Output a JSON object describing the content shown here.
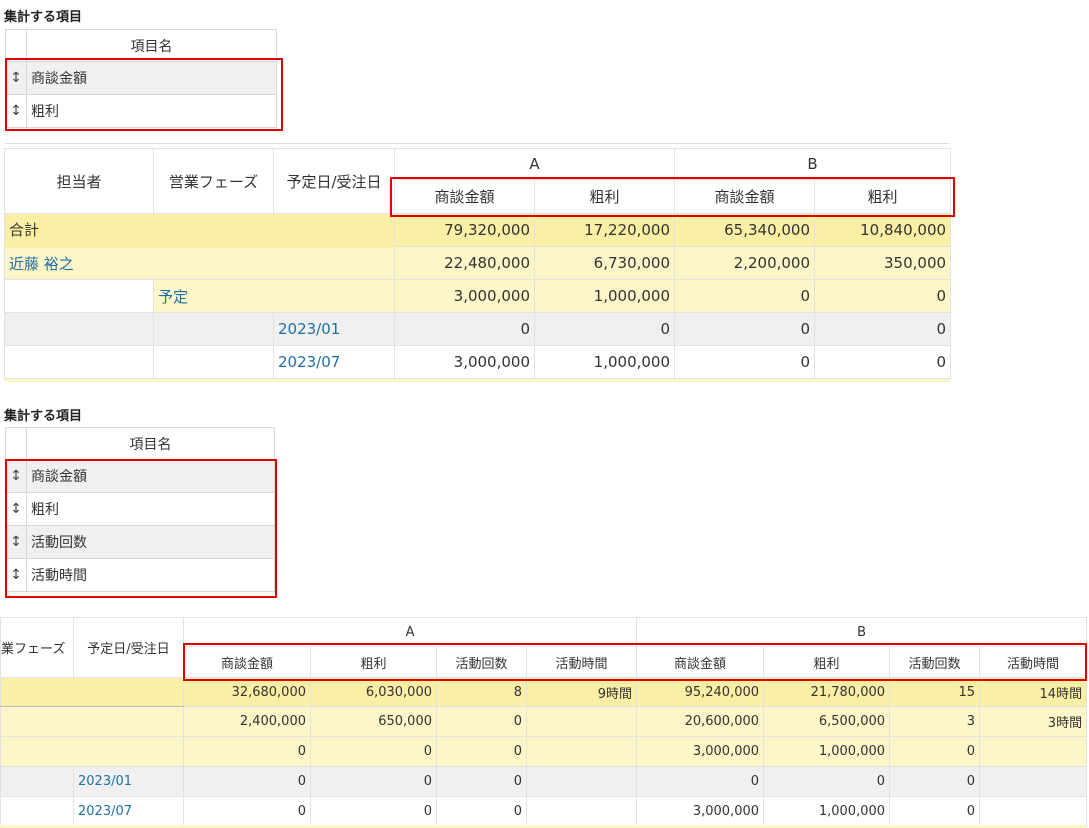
{
  "section1": {
    "title": "集計する項目",
    "header": "項目名",
    "items": [
      {
        "grip": "↕",
        "label": "商談金額"
      },
      {
        "grip": "↕",
        "label": "粗利"
      }
    ]
  },
  "pivot1": {
    "row_headers": [
      "担当者",
      "営業フェーズ",
      "予定日/受注日"
    ],
    "groups": [
      "A",
      "B"
    ],
    "measures": [
      "商談金額",
      "粗利",
      "商談金額",
      "粗利"
    ],
    "rows": [
      {
        "label": "合計",
        "values": [
          "79,320,000",
          "17,220,000",
          "65,340,000",
          "10,840,000"
        ]
      },
      {
        "label": "近藤 裕之",
        "values": [
          "22,480,000",
          "6,730,000",
          "2,200,000",
          "350,000"
        ]
      },
      {
        "label": "予定",
        "values": [
          "3,000,000",
          "1,000,000",
          "0",
          "0"
        ]
      },
      {
        "label": "2023/01",
        "values": [
          "0",
          "0",
          "0",
          "0"
        ]
      },
      {
        "label": "2023/07",
        "values": [
          "3,000,000",
          "1,000,000",
          "0",
          "0"
        ]
      }
    ]
  },
  "section2": {
    "title": "集計する項目",
    "header": "項目名",
    "items": [
      {
        "grip": "↕",
        "label": "商談金額"
      },
      {
        "grip": "↕",
        "label": "粗利"
      },
      {
        "grip": "↕",
        "label": "活動回数"
      },
      {
        "grip": "↕",
        "label": "活動時間"
      }
    ]
  },
  "pivot2": {
    "row_headers": [
      "業フェーズ",
      "予定日/受注日"
    ],
    "groups": [
      "A",
      "B"
    ],
    "measures": [
      "商談金額",
      "粗利",
      "活動回数",
      "活動時間",
      "商談金額",
      "粗利",
      "活動回数",
      "活動時間"
    ],
    "rows": [
      {
        "label": "",
        "values": [
          "32,680,000",
          "6,030,000",
          "8",
          "9時間",
          "95,240,000",
          "21,780,000",
          "15",
          "14時間"
        ]
      },
      {
        "label": "",
        "values": [
          "2,400,000",
          "650,000",
          "0",
          "",
          "20,600,000",
          "6,500,000",
          "3",
          "3時間"
        ]
      },
      {
        "label": "",
        "values": [
          "0",
          "0",
          "0",
          "",
          "3,000,000",
          "1,000,000",
          "0",
          ""
        ]
      },
      {
        "label": "2023/01",
        "values": [
          "0",
          "0",
          "0",
          "",
          "0",
          "0",
          "0",
          ""
        ]
      },
      {
        "label": "2023/07",
        "values": [
          "0",
          "0",
          "0",
          "",
          "3,000,000",
          "1,000,000",
          "0",
          ""
        ]
      }
    ]
  }
}
